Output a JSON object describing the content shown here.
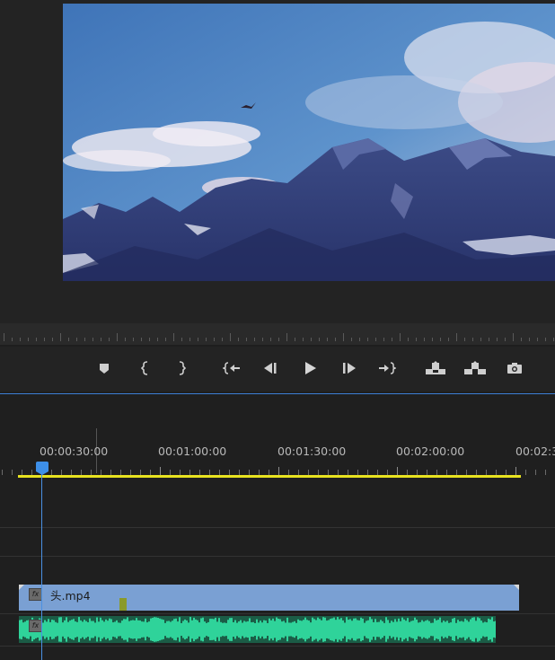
{
  "program_monitor": {
    "video": "mountain-sky-scene"
  },
  "transport": {
    "buttons": [
      {
        "name": "add-marker-button",
        "icon": "marker-icon"
      },
      {
        "name": "mark-in-button",
        "icon": "mark-in-icon"
      },
      {
        "name": "mark-out-button",
        "icon": "mark-out-icon"
      },
      {
        "name": "go-to-in-button",
        "icon": "go-to-in-icon"
      },
      {
        "name": "step-back-button",
        "icon": "step-back-icon"
      },
      {
        "name": "play-button",
        "icon": "play-icon"
      },
      {
        "name": "step-forward-button",
        "icon": "step-forward-icon"
      },
      {
        "name": "go-to-out-button",
        "icon": "go-to-out-icon"
      },
      {
        "name": "lift-button",
        "icon": "lift-icon"
      },
      {
        "name": "extract-button",
        "icon": "extract-icon"
      },
      {
        "name": "export-frame-button",
        "icon": "camera-icon"
      }
    ]
  },
  "timeline": {
    "timecodes": [
      "00:00:30:00",
      "00:01:00:00",
      "00:01:30:00",
      "00:02:00:00",
      "00:02:3"
    ],
    "video_clip": {
      "name": "头.mp4",
      "fx_label": "fx"
    },
    "audio_clip": {
      "fx_label": "fx"
    },
    "colors": {
      "work_area": "#e8e320",
      "playhead": "#3d8fe8",
      "video_clip": "#7aa0d3",
      "audio_clip": "#1b5c46",
      "waveform": "#2fd39a"
    }
  }
}
